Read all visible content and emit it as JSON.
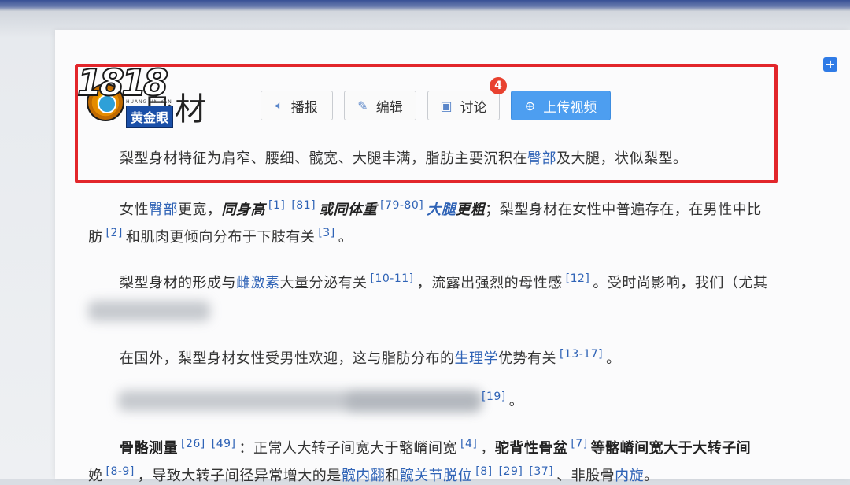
{
  "overlay": {
    "logo_number": "1818",
    "logo_pinyin": "HUANG JIN YAN",
    "logo_badge": "黄金眼"
  },
  "page": {
    "title": "身材",
    "actions": {
      "read_label": "播报",
      "edit_label": "编辑",
      "discuss_label": "讨论",
      "discuss_count": "4",
      "upload_label": "上传视频"
    },
    "summary": {
      "before": "梨型身材特征为肩窄、腰细、髋宽、大腿丰满，脂肪主要沉积在",
      "link": "臀部",
      "after": "及大腿，状似梨型。"
    },
    "para1": {
      "t1": "女性",
      "l1": "臀部",
      "t2": "更宽，",
      "b1": "同身高",
      "r1": "[1]",
      "r2": "[81]",
      "b2": "或同体重",
      "r3": "[79-80]",
      "bl1": "大腿",
      "b3": "更粗",
      "t3": "；梨型身材在女性中普遍存在，在男性中比",
      "line2_t1": "肪",
      "r4": "[2]",
      "line2_t2": "和肌肉更倾向分布于下肢有关",
      "r5": "[3]",
      "line2_t3": "。"
    },
    "para2": {
      "t1": "梨型身材的形成与",
      "l1": "雌激素",
      "t2": "大量分泌有关",
      "r1": "[10-11]",
      "t3": "，流露出强烈的母性感",
      "r2": "[12]",
      "t4": "。受时尚影响，我们（尤其"
    },
    "para3": {
      "t1": "在国外，梨型身材女性受男性欢迎，这与脂肪分布的",
      "l1": "生理学",
      "t2": "优势有关",
      "r1": "[13-17]",
      "t3": "。"
    },
    "para4": {
      "r1": "[19]",
      "t1": "。"
    },
    "para5": {
      "b1": "骨骼测量",
      "r1": "[26]",
      "r2": "[49]",
      "t1": "：正常人大转子间宽大于髂嵴间宽",
      "r3": "[4]",
      "t2": "，",
      "b2": "驼背性骨盆",
      "r4": "[7]",
      "b3": "等髂嵴间宽大于大转子间",
      "line2_t1": "娩",
      "r5": "[8-9]",
      "line2_t2": "，导致大转子间径异常增大的是",
      "l1": "髋内翻",
      "line2_t3": "和",
      "l2": "髋关节脱位",
      "r6": "[8]",
      "r7": "[29]",
      "r8": "[37]",
      "line2_t4": "、非股骨",
      "l3": "内旋",
      "line2_t5": "。"
    }
  },
  "colors": {
    "highlight_box": "#e2262b",
    "link": "#2f63b6",
    "upload_button": "#4d9ef0",
    "count_badge": "#e8412f"
  }
}
